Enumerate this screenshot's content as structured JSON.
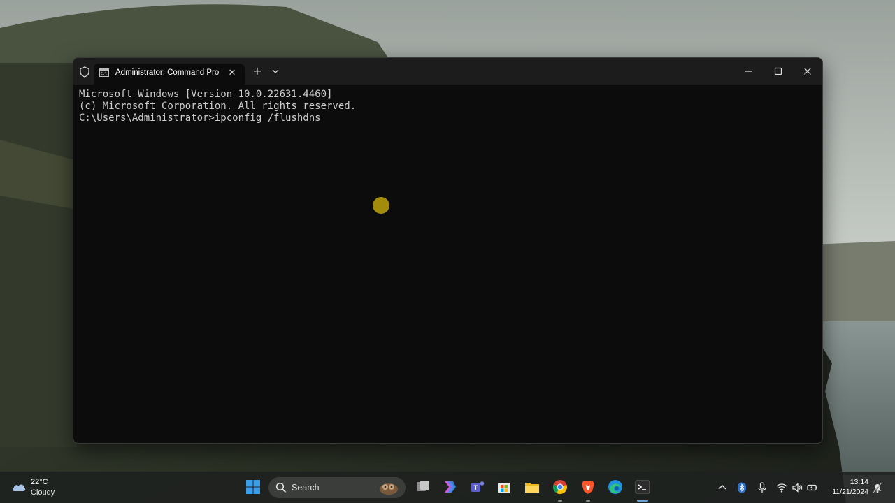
{
  "terminal": {
    "tab_title": "Administrator: Command Pro",
    "tab_close": "✕",
    "new_tab": "+",
    "lines": [
      "Microsoft Windows [Version 10.0.22631.4460]",
      "(c) Microsoft Corporation. All rights reserved.",
      "",
      "C:\\Users\\Administrator>ipconfig /flushdns"
    ]
  },
  "taskbar": {
    "weather": {
      "temp": "22°C",
      "condition": "Cloudy"
    },
    "search": {
      "label": "Search"
    },
    "clock": {
      "time": "13:14",
      "date": "11/21/2024"
    }
  },
  "colors": {
    "console_bg": "#0c0c0c",
    "console_text": "#cccccc",
    "titlebar": "#1c1c1c",
    "cursor_highlight": "#b49a0c",
    "taskbar_running": "#6c9fd6"
  }
}
